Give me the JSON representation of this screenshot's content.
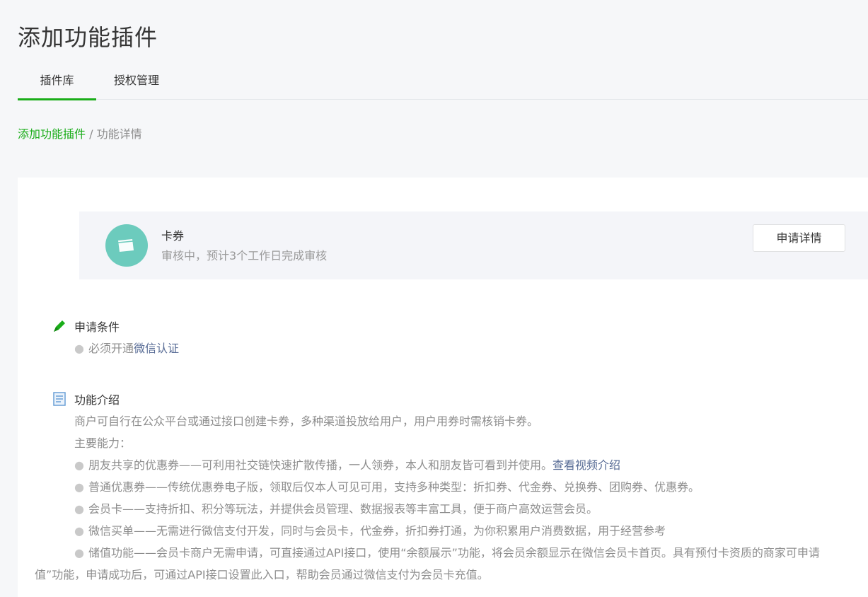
{
  "header": {
    "title": "添加功能插件"
  },
  "tabs": [
    {
      "label": "插件库",
      "active": true
    },
    {
      "label": "授权管理",
      "active": false
    }
  ],
  "breadcrumb": {
    "link": "添加功能插件",
    "separator": " / ",
    "current": "功能详情"
  },
  "plugin": {
    "name": "卡券",
    "status": "审核中，预计3个工作日完成审核",
    "button_label": "申请详情",
    "logo_icon": "card-icon",
    "logo_color": "#6ccbbd"
  },
  "conditions": {
    "title": "申请条件",
    "icon": "pencil-icon",
    "items": [
      {
        "prefix": "必须开通",
        "link": "微信认证"
      }
    ]
  },
  "intro": {
    "title": "功能介绍",
    "icon": "document-icon",
    "summary": "商户可自行在公众平台或通过接口创建卡券，多种渠道投放给用户，用户用券时需核销卡券。",
    "capabilities_label": "主要能力：",
    "items": [
      {
        "text": "朋友共享的优惠券——可利用社交链快速扩散传播，一人领券，本人和朋友皆可看到并使用。",
        "link": "查看视频介绍"
      },
      {
        "text": "普通优惠券——传统优惠券电子版，领取后仅本人可见可用，支持多种类型：折扣券、代金券、兑换券、团购券、优惠券。"
      },
      {
        "text": "会员卡——支持折扣、积分等玩法，并提供会员管理、数据报表等丰富工具，便于商户高效运营会员。"
      },
      {
        "text": "微信买单——无需进行微信支付开发，同时与会员卡，代金券，折扣券打通，为你积累用户消费数据，用于经营参考"
      },
      {
        "text": "储值功能——会员卡商户无需申请，可直接通过API接口，使用“余额展示”功能，将会员余额显示在微信会员卡首页。具有预付卡资质的商家可申请",
        "continuation": "值”功能，申请成功后，可通过API接口设置此入口，帮助会员通过微信支付为会员卡充值。"
      }
    ]
  },
  "colors": {
    "accent": "#1aad19",
    "link": "#576b95"
  }
}
